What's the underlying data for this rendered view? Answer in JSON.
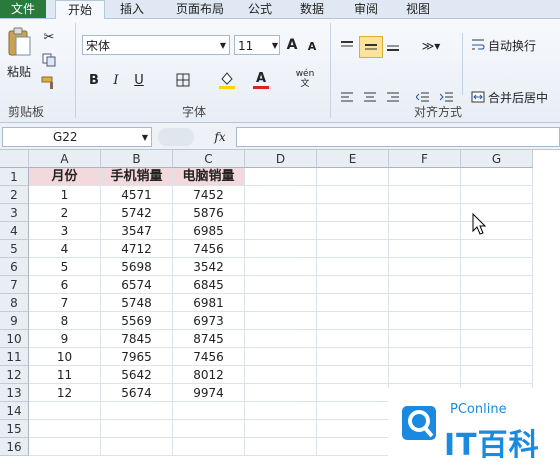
{
  "tabs": [
    "文件",
    "开始",
    "插入",
    "页面布局",
    "公式",
    "数据",
    "审阅",
    "视图"
  ],
  "clipboard": {
    "paste": "粘贴",
    "label": "剪贴板"
  },
  "font": {
    "name": "宋体",
    "size": "11",
    "label": "字体",
    "bold": "B",
    "italic": "I",
    "underline": "U",
    "grow": "A",
    "shrink": "A",
    "color": "A",
    "wen": "wén文"
  },
  "align": {
    "wrap": "自动换行",
    "merge": "合并后居中",
    "label": "对齐方式"
  },
  "namebox": "G22",
  "fx": "fx",
  "columns": [
    "A",
    "B",
    "C",
    "D",
    "E",
    "F",
    "G"
  ],
  "rows": [
    "1",
    "2",
    "3",
    "4",
    "5",
    "6",
    "7",
    "8",
    "9",
    "10",
    "11",
    "12",
    "13",
    "14",
    "15",
    "16"
  ],
  "table": {
    "headers": [
      "月份",
      "手机销量",
      "电脑销量"
    ],
    "data": [
      [
        "1",
        "4571",
        "7452"
      ],
      [
        "2",
        "5742",
        "5876"
      ],
      [
        "3",
        "3547",
        "6985"
      ],
      [
        "4",
        "4712",
        "7456"
      ],
      [
        "5",
        "5698",
        "3542"
      ],
      [
        "6",
        "6574",
        "6845"
      ],
      [
        "7",
        "5748",
        "6981"
      ],
      [
        "8",
        "5569",
        "6973"
      ],
      [
        "9",
        "7845",
        "8745"
      ],
      [
        "10",
        "7965",
        "7456"
      ],
      [
        "11",
        "5642",
        "8012"
      ],
      [
        "12",
        "5674",
        "9974"
      ]
    ]
  },
  "watermark": {
    "brand": "PConline",
    "text": "IT百科"
  },
  "colors": {
    "header_fill": "#f3d9dc",
    "file_tab": "#2a7a3c",
    "watermark": "#1a8ae0"
  }
}
